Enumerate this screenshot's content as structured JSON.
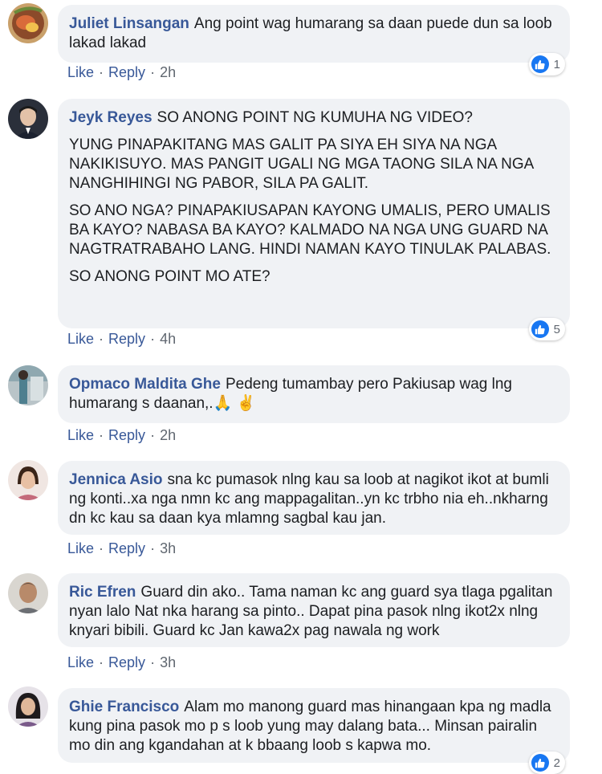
{
  "colors": {
    "bubble": "#f0f2f5",
    "name": "#385898",
    "like_blue": "#1877f2",
    "meta": "#606770"
  },
  "actions": {
    "like": "Like",
    "reply": "Reply",
    "dot": "·"
  },
  "comments": [
    {
      "name": "Juliet Linsangan",
      "first_line": "Ang point wag humarang sa daan puede dun sa loob lakad lakad",
      "time": "2h",
      "reactions": "1"
    },
    {
      "name": "Jeyk Reyes",
      "first_line": "SO ANONG POINT NG KUMUHA NG VIDEO?",
      "paragraphs": [
        "YUNG PINAPAKITANG MAS GALIT PA SIYA EH SIYA NA NGA NAKIKISUYO. MAS PANGIT UGALI NG MGA TAONG SILA NA NGA NANGHIHINGI NG PABOR, SILA PA GALIT.",
        "SO ANO NGA? PINAPAKIUSAPAN KAYONG UMALIS, PERO UMALIS BA KAYO? NABASA BA KAYO? KALMADO NA NGA UNG GUARD NA NAGTRATRABAHO LANG. HINDI NAMAN KAYO TINULAK PALABAS.",
        "SO ANONG POINT MO ATE?"
      ],
      "time": "4h",
      "reactions": "5"
    },
    {
      "name": "Opmaco Maldita Ghe",
      "first_line": "Pedeng tumambay pero Pakiusap wag lng humarang s daanan,.🙏 ✌️",
      "time": "2h"
    },
    {
      "name": "Jennica Asio",
      "first_line": "sna kc pumasok nlng kau sa loob at nagikot ikot at bumli ng konti..xa nga nmn kc ang mappagalitan..yn kc trbho nia eh..nkharng dn kc kau sa daan kya mlamng sagbal kau jan.",
      "time": "3h"
    },
    {
      "name": "Ric Efren",
      "first_line": "Guard din ako.. Tama naman kc ang guard sya tlaga pgalitan nyan lalo Nat nka harang sa pinto.. Dapat pina pasok nlng ikot2x nlng knyari bibili. Guard kc Jan kawa2x pag nawala ng work",
      "time": "3h"
    },
    {
      "name": "Ghie Francisco",
      "first_line": "Alam mo manong guard mas hinangaan kpa ng madla kung pina pasok mo p s loob yung may dalang bata... Minsan pairalin mo din ang kgandahan at k bbaang loob s kapwa mo.",
      "reactions": "2"
    }
  ]
}
